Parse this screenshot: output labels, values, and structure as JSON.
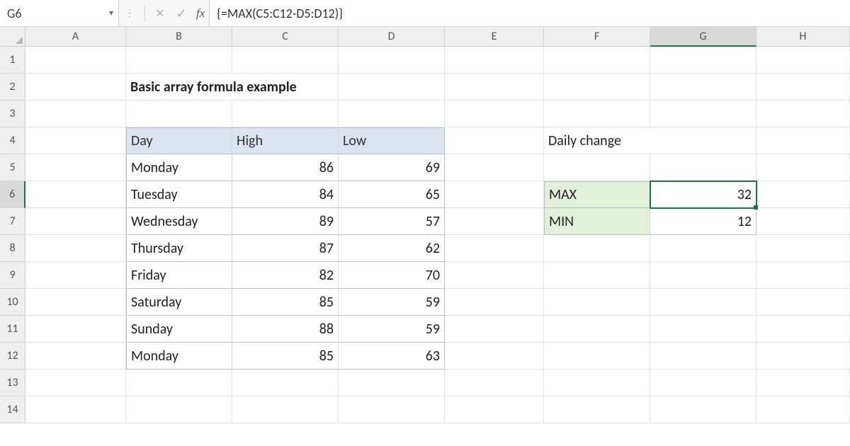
{
  "name_box": "G6",
  "formula": "{=MAX(C5:C12-D5:D12)}",
  "fx_label": "fx",
  "columns": [
    "A",
    "B",
    "C",
    "D",
    "E",
    "F",
    "G",
    "H"
  ],
  "rows": [
    "1",
    "2",
    "3",
    "4",
    "5",
    "6",
    "7",
    "8",
    "9",
    "10",
    "11",
    "12",
    "13",
    "14"
  ],
  "title": "Basic array formula example",
  "table": {
    "headers": {
      "day": "Day",
      "high": "High",
      "low": "Low"
    },
    "rows": [
      {
        "day": "Monday",
        "high": "86",
        "low": "69"
      },
      {
        "day": "Tuesday",
        "high": "84",
        "low": "65"
      },
      {
        "day": "Wednesday",
        "high": "89",
        "low": "57"
      },
      {
        "day": "Thursday",
        "high": "87",
        "low": "62"
      },
      {
        "day": "Friday",
        "high": "82",
        "low": "70"
      },
      {
        "day": "Saturday",
        "high": "85",
        "low": "59"
      },
      {
        "day": "Sunday",
        "high": "88",
        "low": "59"
      },
      {
        "day": "Monday",
        "high": "85",
        "low": "63"
      }
    ]
  },
  "summary": {
    "title": "Daily change",
    "max_label": "MAX",
    "max_value": "32",
    "min_label": "MIN",
    "min_value": "12"
  },
  "active": {
    "col": "G",
    "row": "6"
  }
}
